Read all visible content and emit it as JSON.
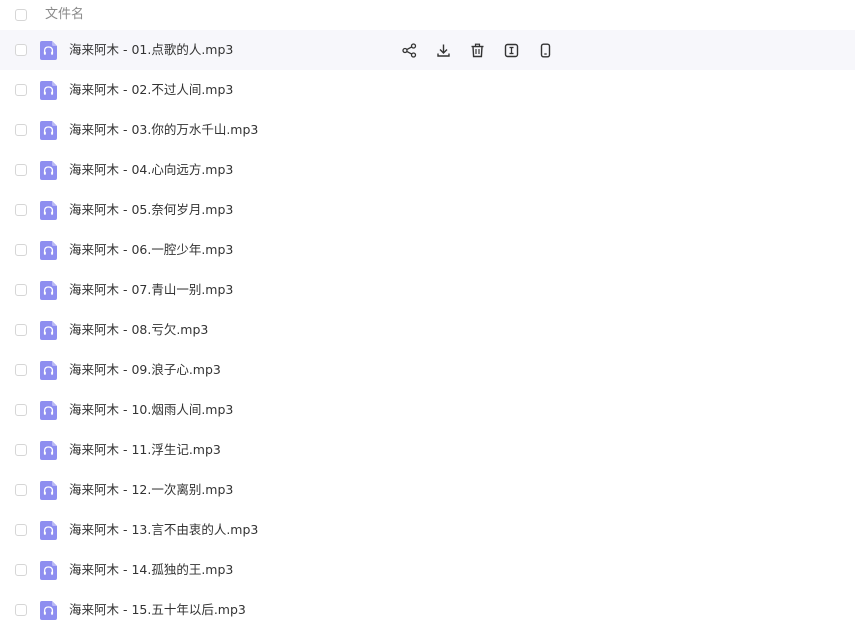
{
  "header": {
    "column_label": "文件名"
  },
  "accent_color": "#8e8ef0",
  "files": [
    {
      "name": "海来阿木 - 01.点歌的人.mp3"
    },
    {
      "name": "海来阿木 - 02.不过人间.mp3"
    },
    {
      "name": "海来阿木 - 03.你的万水千山.mp3"
    },
    {
      "name": "海来阿木 - 04.心向远方.mp3"
    },
    {
      "name": "海来阿木 - 05.奈何岁月.mp3"
    },
    {
      "name": "海来阿木 - 06.一腔少年.mp3"
    },
    {
      "name": "海来阿木 - 07.青山一别.mp3"
    },
    {
      "name": "海来阿木 - 08.亏欠.mp3"
    },
    {
      "name": "海来阿木 - 09.浪子心.mp3"
    },
    {
      "name": "海来阿木 - 10.烟雨人间.mp3"
    },
    {
      "name": "海来阿木 - 11.浮生记.mp3"
    },
    {
      "name": "海来阿木 - 12.一次离别.mp3"
    },
    {
      "name": "海来阿木 - 13.言不由衷的人.mp3"
    },
    {
      "name": "海来阿木 - 14.孤独的王.mp3"
    },
    {
      "name": "海来阿木 - 15.五十年以后.mp3"
    }
  ],
  "row_actions": [
    {
      "icon": "share-icon"
    },
    {
      "icon": "download-icon"
    },
    {
      "icon": "delete-icon"
    },
    {
      "icon": "rename-icon"
    },
    {
      "icon": "send-to-phone-icon"
    }
  ]
}
